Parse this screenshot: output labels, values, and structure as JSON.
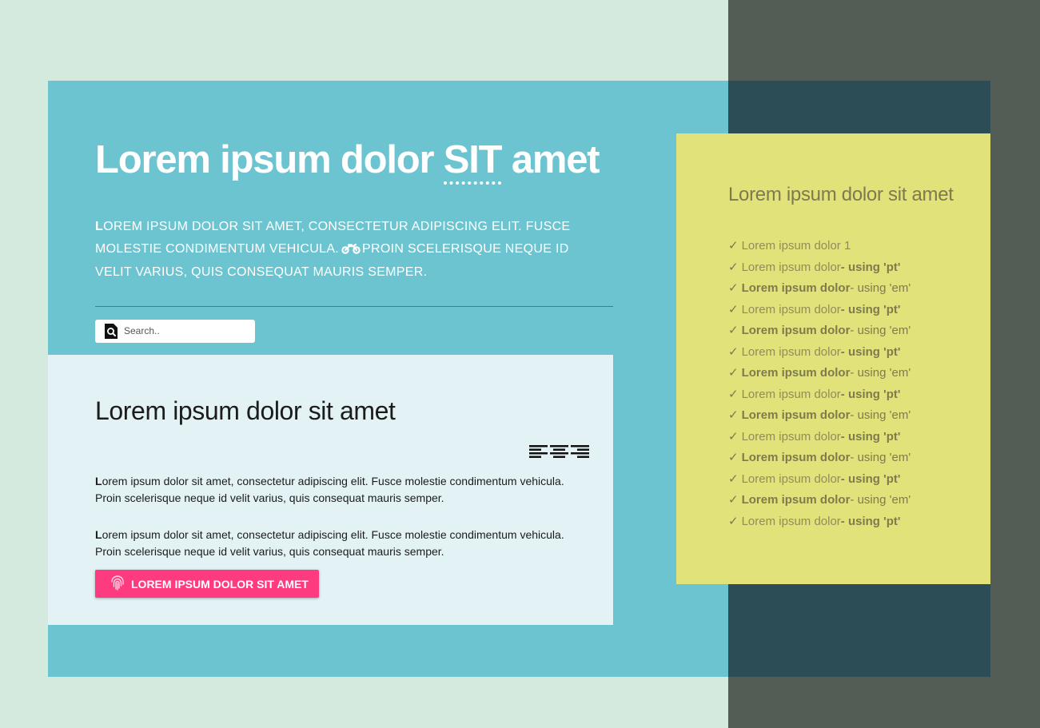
{
  "colors": {
    "page_bg": "#d5eadf",
    "right_bg": "#545c56",
    "main_panel": "#6dc4d1",
    "dark_panel": "#2c4d55",
    "card_bg": "#e2f2f5",
    "sidebar_bg": "#e2e27a",
    "divider": "#c0475a",
    "cta": "#fd3b7e"
  },
  "hero": {
    "title_pre": "Lorem ipsum dolor ",
    "title_abbr": "SIT",
    "title_post": " amet",
    "lead_cap": "L",
    "lead_part1": "OREM IPSUM DOLOR SIT AMET, CONSECTETUR ADIPISCING ELIT. FUSCE MOLESTIE CONDIMENTUM VEHICULA.",
    "lead_icon": "motorcycle-icon",
    "lead_part2": "PROIN SCELERISQUE NEQUE ID VELIT VARIUS, QUIS CONSEQUAT MAURIS SEMPER."
  },
  "search": {
    "icon": "search-icon",
    "placeholder": "Search..",
    "value": ""
  },
  "card": {
    "title": "Lorem ipsum dolor sit amet",
    "align_icons": [
      "align-left-icon",
      "align-center-icon",
      "align-right-icon"
    ],
    "paragraphs": [
      {
        "cap": "L",
        "text": "orem ipsum dolor sit amet, consectetur adipiscing elit. Fusce molestie condimentum vehicula. Proin scelerisque neque id velit varius, quis consequat mauris semper."
      },
      {
        "cap": "L",
        "text": "orem ipsum dolor sit amet, consectetur adipiscing elit. Fusce molestie condimentum vehicula. Proin scelerisque neque id velit varius, quis consequat mauris semper."
      }
    ],
    "button_icon": "fingerprint-icon",
    "button_label": "LOREM IPSUM DOLOR SIT AMET"
  },
  "sidebar": {
    "title": "Lorem ipsum dolor sit amet",
    "check": "✓",
    "items": [
      {
        "text": "Lorem ipsum dolor 1",
        "suffix": ""
      },
      {
        "text": "Lorem ipsum dolor",
        "suffix": "- using 'pt'"
      },
      {
        "text": "Lorem ipsum dolor",
        "suffix": "- using 'em'"
      },
      {
        "text": "Lorem ipsum dolor",
        "suffix": "- using 'pt'"
      },
      {
        "text": "Lorem ipsum dolor",
        "suffix": "- using 'em'"
      },
      {
        "text": "Lorem ipsum dolor",
        "suffix": "- using 'pt'"
      },
      {
        "text": "Lorem ipsum dolor",
        "suffix": "- using 'em'"
      },
      {
        "text": "Lorem ipsum dolor",
        "suffix": "- using 'pt'"
      },
      {
        "text": "Lorem ipsum dolor",
        "suffix": "- using 'em'"
      },
      {
        "text": "Lorem ipsum dolor",
        "suffix": "- using 'pt'"
      },
      {
        "text": "Lorem ipsum dolor",
        "suffix": "- using 'em'"
      },
      {
        "text": "Lorem ipsum dolor",
        "suffix": "- using 'pt'"
      },
      {
        "text": "Lorem ipsum dolor",
        "suffix": "- using 'em'"
      },
      {
        "text": "Lorem ipsum dolor",
        "suffix": "- using 'pt'"
      }
    ]
  }
}
